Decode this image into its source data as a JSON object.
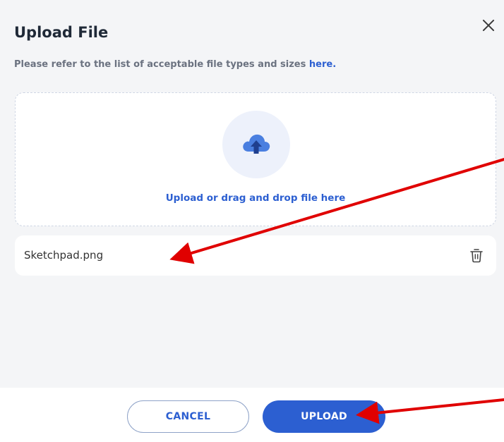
{
  "dialog": {
    "title": "Upload File",
    "subtitle_text": "Please refer to the list of acceptable file types and sizes ",
    "subtitle_link": "here."
  },
  "dropzone": {
    "icon": "cloud-upload-icon",
    "text": "Upload or drag and drop file here"
  },
  "file": {
    "name": "Sketchpad.png",
    "delete_icon": "trash-icon"
  },
  "buttons": {
    "cancel_label": "CANCEL",
    "upload_label": "UPLOAD"
  },
  "colors": {
    "accent": "#2c5fd1",
    "annotation": "#e00000",
    "panel_background": "#f4f5f7"
  }
}
